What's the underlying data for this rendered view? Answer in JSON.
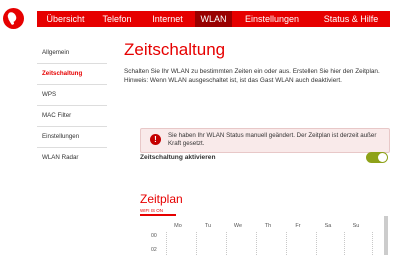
{
  "logo": {
    "icon": "vodafone-logo-icon"
  },
  "topnav": {
    "tabs": [
      {
        "label": "Übersicht",
        "active": false
      },
      {
        "label": "Telefon",
        "active": false
      },
      {
        "label": "Internet",
        "active": false
      },
      {
        "label": "WLAN",
        "active": true
      },
      {
        "label": "Einstellungen",
        "active": false
      },
      {
        "label": "Status & Hilfe",
        "active": false
      }
    ]
  },
  "sidebar": {
    "items": [
      {
        "label": "Allgemein",
        "active": false
      },
      {
        "label": "Zeitschaltung",
        "active": true
      },
      {
        "label": "WPS",
        "active": false
      },
      {
        "label": "MAC Filter",
        "active": false
      },
      {
        "label": "Einstellungen",
        "active": false
      },
      {
        "label": "WLAN Radar",
        "active": false
      }
    ]
  },
  "main": {
    "title": "Zeitschaltung",
    "intro_line1": "Schalten Sie Ihr WLAN zu bestimmten Zeiten ein oder aus. Erstellen Sie hier den Zeitplan.",
    "intro_line2": "Hinweis: Wenn WLAN ausgeschaltet ist, ist das Gast WLAN auch deaktiviert.",
    "alert": {
      "icon": "!",
      "text": "Sie haben Ihr WLAN Status manuell geändert. Der Zeitplan ist derzeit außer Kraft gesetzt."
    },
    "toggle": {
      "label": "Zeitschaltung aktivieren",
      "state": "on"
    },
    "schedule": {
      "title": "Zeitplan",
      "subtab": "WIFI IS ON",
      "days": [
        "Mo",
        "Tu",
        "We",
        "Th",
        "Fr",
        "Sa",
        "Su"
      ],
      "hours": [
        "00",
        "02"
      ]
    }
  },
  "colors": {
    "brand_red": "#e60000",
    "active_tab": "#990000",
    "toggle_on": "#8ea219",
    "alert_bg": "#f9eaea"
  }
}
